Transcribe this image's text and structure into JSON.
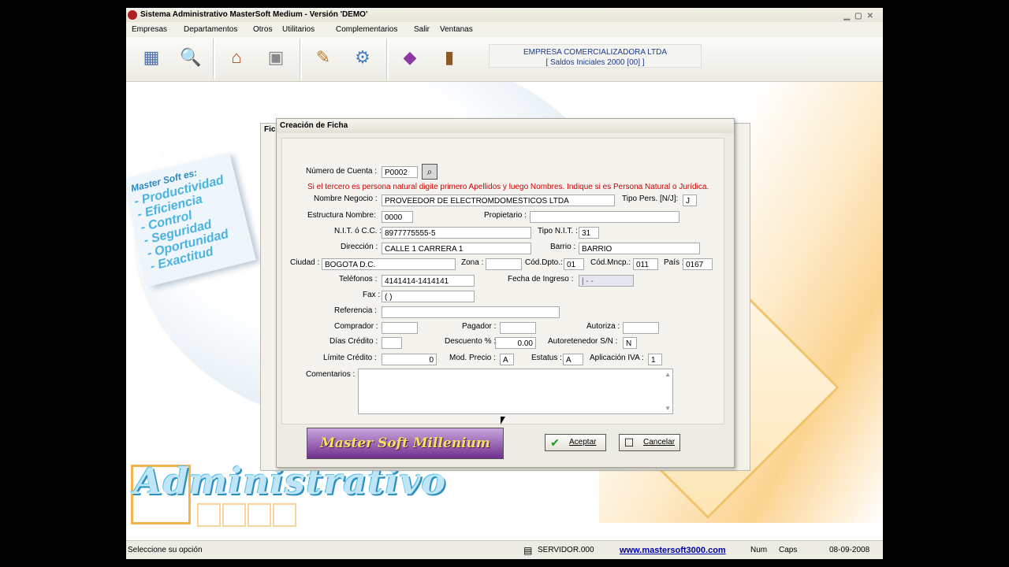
{
  "window": {
    "title": "Sistema Administrativo MasterSoft Medium   -   Versión 'DEMO'"
  },
  "menu": [
    "Empresas",
    "Departamentos",
    "Otros",
    "Utilitarios",
    "Complementarios",
    "Salir",
    "Ventanas"
  ],
  "toolbar": {
    "icons": [
      "calculator-icon",
      "search-icon",
      "home-icon",
      "safe-icon",
      "tools-icon",
      "settings-icon",
      "book-icon",
      "exit-door-icon"
    ],
    "company_line1": "EMPRESA COMERCIALIZADORA LTDA",
    "company_line2": "[ Saldos Iniciales 2000 [00] ]"
  },
  "desktop": {
    "slogan_title": "Master Soft es:",
    "slogans": [
      "- Productividad",
      "- Eficiencia",
      "- Control",
      "- Seguridad",
      "- Oportunidad",
      "- Exactitud"
    ],
    "brand": "Administrativo"
  },
  "background_window": {
    "title": "Fic"
  },
  "dialog": {
    "title": "Creación de Ficha",
    "warning": "Si el tercero es persona natural digite primero Apellidos y luego Nombres. Indique si es Persona Natural o Jurídica.",
    "labels": {
      "numero_cuenta": "Número de Cuenta :",
      "nombre_negocio": "Nombre Negocio :",
      "tipo_pers": "Tipo Pers. [N/J]:",
      "estructura_nombre": "Estructura Nombre:",
      "propietario": "Propietario :",
      "nit": "N.I.T. ó C.C. :",
      "tipo_nit": "Tipo N.I.T. :",
      "direccion": "Dirección :",
      "barrio": "Barrio :",
      "ciudad": "Ciudad :",
      "zona": "Zona :",
      "cod_dpto": "Cód.Dpto.:",
      "cod_mncp": "Cód.Mncp.:",
      "pais": "País :",
      "telefonos": "Teléfonos :",
      "fecha_ingreso": "Fecha de Ingreso :",
      "fax": "Fax :",
      "referencia": "Referencia :",
      "comprador": "Comprador :",
      "pagador": "Pagador :",
      "autoriza": "Autoriza :",
      "dias_credito": "Días Crédito :",
      "descuento": "Descuento % :",
      "autoretenedor": "Autoretenedor S/N :",
      "limite_credito": "Límite Crédito :",
      "mod_precio": "Mod. Precio :",
      "estatus": "Estatus :",
      "aplicacion_iva": "Aplicación IVA :",
      "comentarios": "Comentarios :"
    },
    "values": {
      "numero_cuenta": "P0002",
      "nombre_negocio": "PROVEEDOR DE ELECTROMDOMESTICOS LTDA",
      "tipo_pers": "J",
      "estructura_nombre": "0000",
      "propietario": "",
      "nit": "8977775555-5",
      "tipo_nit": "31",
      "direccion": "CALLE 1 CARRERA 1",
      "barrio": "BARRIO",
      "ciudad": "BOGOTA D.C.",
      "zona": "",
      "cod_dpto": "01",
      "cod_mncp": "011",
      "pais": "0167",
      "telefonos": "4141414-1414141",
      "fecha_ingreso": "| - -",
      "fax": "(  )",
      "referencia": "",
      "comprador": "",
      "pagador": "",
      "autoriza": "",
      "dias_credito": "",
      "descuento": "0.00",
      "autoretenedor": "N",
      "limite_credito": "0",
      "mod_precio": "A",
      "estatus": "A",
      "aplicacion_iva": "1",
      "comentarios": ""
    },
    "logo": "Master Soft Millenium",
    "buttons": {
      "accept": "Aceptar",
      "cancel": "Cancelar"
    }
  },
  "status": {
    "message": "Seleccione su opción",
    "server": "SERVIDOR.000",
    "website": "www.mastersoft3000.com",
    "num": "Num",
    "caps": "Caps",
    "date": "08-09-2008"
  }
}
